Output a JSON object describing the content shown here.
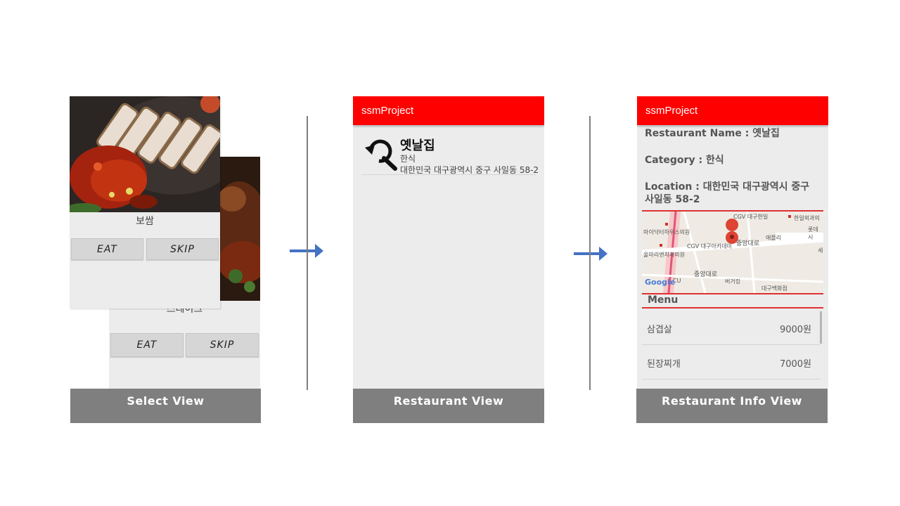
{
  "select_view": {
    "front_card": {
      "food_name": "보쌈",
      "eat_label": "EAT",
      "skip_label": "SKIP"
    },
    "back_card": {
      "food_name": "스테이크",
      "eat_label": "EAT",
      "skip_label": "SKIP"
    },
    "caption": "Select View"
  },
  "restaurant_view": {
    "app_title": "ssmProject",
    "items": [
      {
        "name": "옛날집",
        "category": "한식",
        "address": "대한민국 대구광역시 중구 사일동 58-2",
        "icon": "search-refresh-icon"
      }
    ],
    "caption": "Restaurant View"
  },
  "restaurant_info_view": {
    "app_title": "ssmProject",
    "name_line": "Restaurant Name : 옛날집",
    "category_line": "Category : 한식",
    "location_line": "Location : 대한민국 대구광역시 중구 사일동 58-2",
    "map": {
      "labels": [
        "CGV 대구한일",
        "한일외과의",
        "롯데시",
        "마이닥터하우스의원",
        "CGV 대구아카데미",
        "중앙대로",
        "애플리",
        "울마리앤치과의원",
        "중앙대로",
        "버거킹",
        "대구백화점",
        "CU",
        "세"
      ],
      "logo": "Google"
    },
    "menu_title": "Menu",
    "menu": [
      {
        "name": "삼겹살",
        "price": "9000원"
      },
      {
        "name": "된장찌개",
        "price": "7000원"
      }
    ],
    "caption": "Restaurant  Info  View"
  },
  "colors": {
    "accent": "#ff0000",
    "caption_bg": "#7f7f7f",
    "arrow": "#4472c4"
  }
}
